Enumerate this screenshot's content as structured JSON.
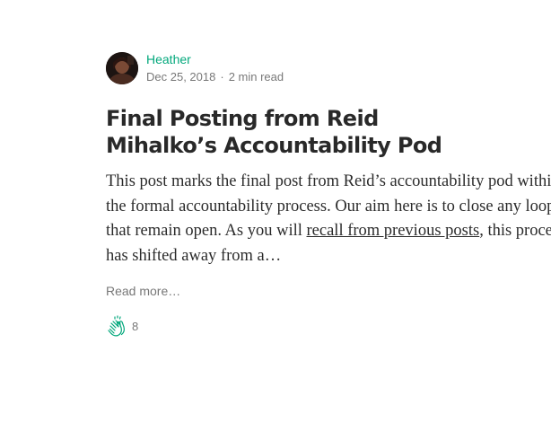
{
  "post": {
    "author_name": "Heather",
    "date": "Dec 25, 2018",
    "separator": "·",
    "read_time": "2 min read",
    "title": "Final Posting from Reid Mihalko’s Accountability Pod",
    "excerpt": {
      "line1": "This post marks the final post from Reid’s accountability pod within",
      "line2": "the formal accountability process. Our aim here is to close any loops",
      "line3_before_link": "that remain open. As you will ",
      "link_text": "recall from previous posts",
      "line3_after_link": ", this process",
      "line4": "has shifted away from a…"
    },
    "read_more": "Read more…",
    "claps": "8"
  },
  "colors": {
    "author_green": "#03a87c",
    "clap_green": "#03a87c",
    "text_primary": "rgba(0,0,0,0.84)",
    "text_secondary": "rgba(0,0,0,0.54)"
  },
  "icons": {
    "clap": "clap-icon"
  }
}
